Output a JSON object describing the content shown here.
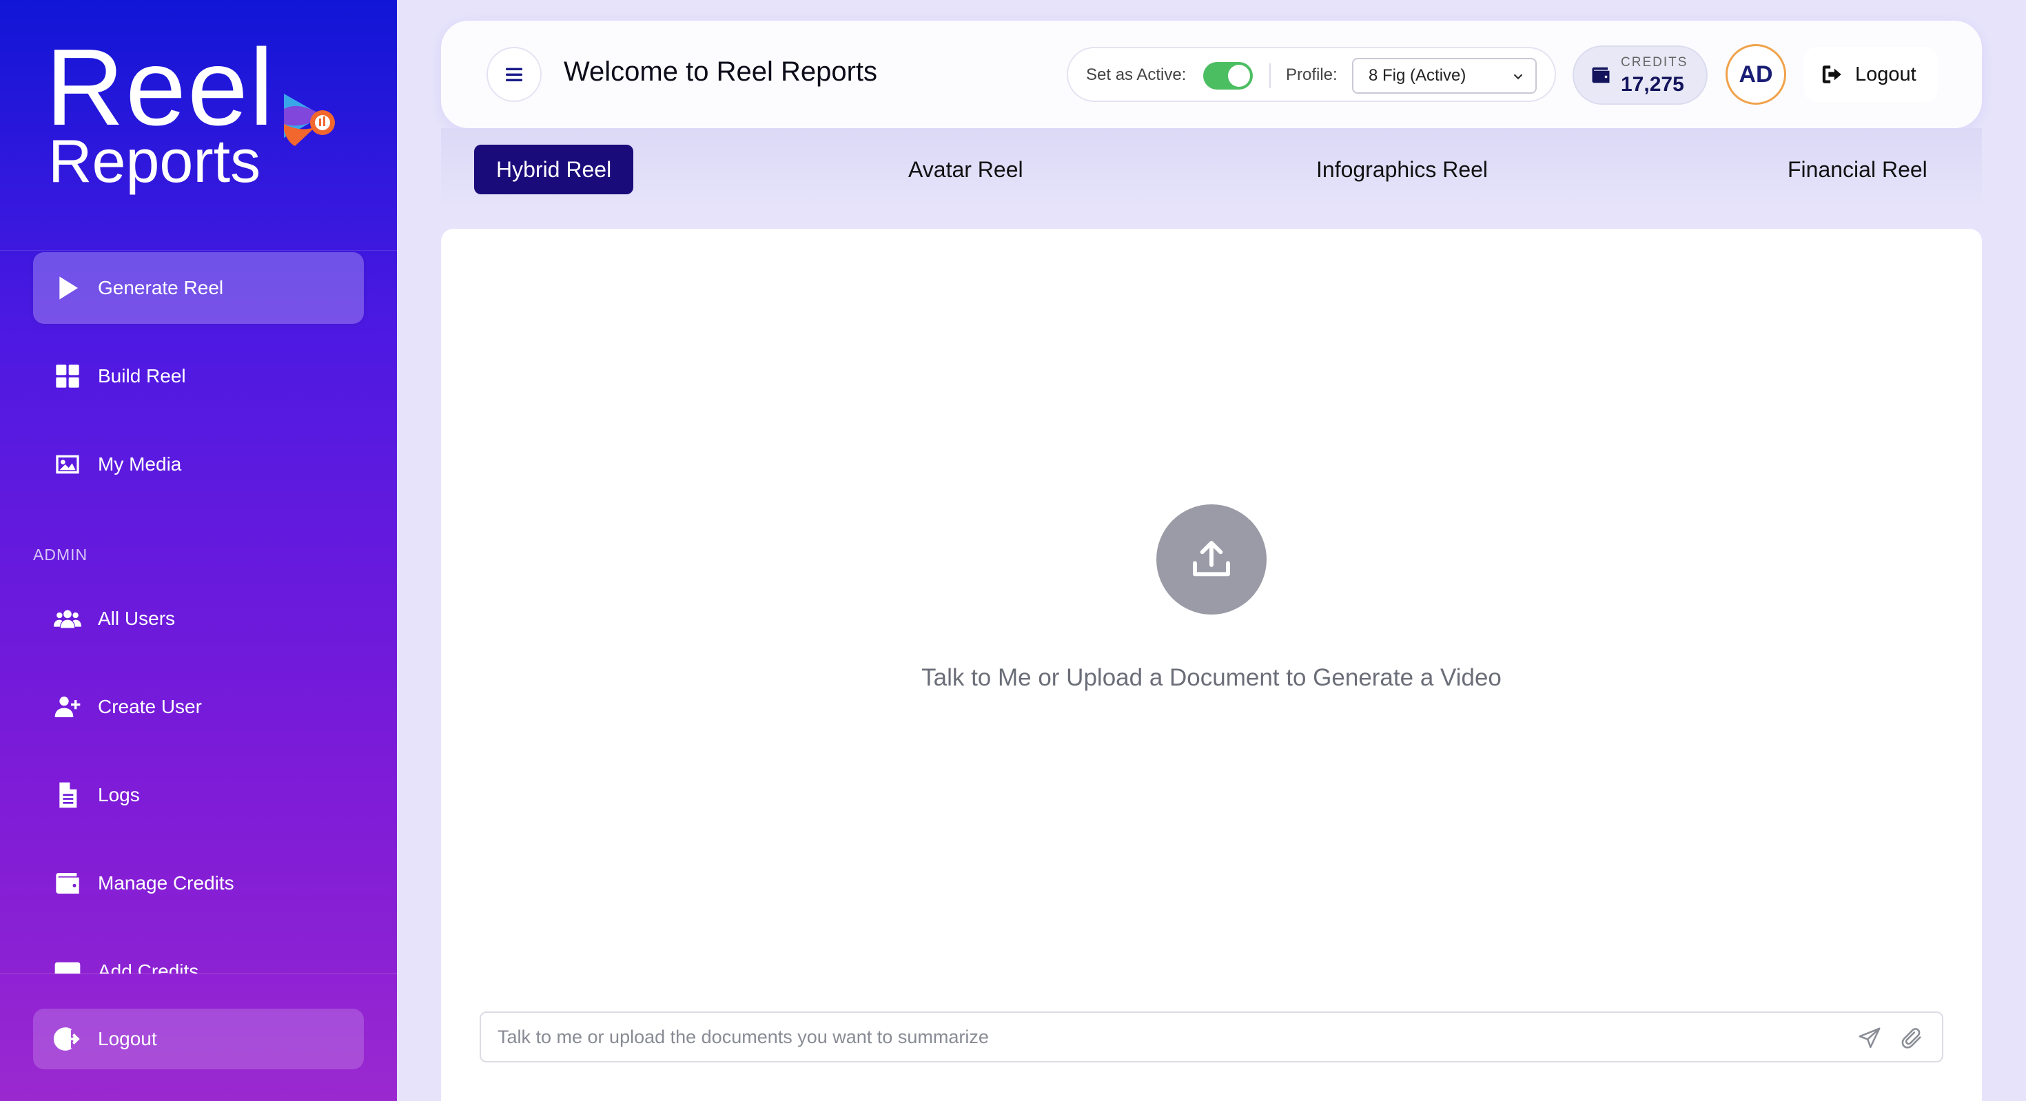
{
  "brand": {
    "logo_line1": "Reel",
    "logo_line2": "Reports"
  },
  "sidebar": {
    "items": [
      {
        "label": "Generate Reel",
        "icon": "play-icon",
        "active": true
      },
      {
        "label": "Build Reel",
        "icon": "grid-icon"
      },
      {
        "label": "My Media",
        "icon": "image-icon"
      }
    ],
    "admin_label": "ADMIN",
    "admin_items": [
      {
        "label": "All Users",
        "icon": "users-icon"
      },
      {
        "label": "Create User",
        "icon": "user-plus-icon"
      },
      {
        "label": "Logs",
        "icon": "file-icon"
      },
      {
        "label": "Manage Credits",
        "icon": "wallet-icon"
      },
      {
        "label": "Add Credits",
        "icon": "card-icon"
      }
    ],
    "logout_label": "Logout"
  },
  "header": {
    "title": "Welcome to Reel Reports",
    "set_active_label": "Set as Active:",
    "set_active_on": true,
    "profile_label": "Profile:",
    "profile_value": "8 Fig (Active)",
    "credits_label": "CREDITS",
    "credits_value": "17,275",
    "avatar_initials": "AD",
    "logout_label": "Logout"
  },
  "tabs": [
    {
      "label": "Hybrid Reel",
      "active": true
    },
    {
      "label": "Avatar Reel"
    },
    {
      "label": "Infographics Reel"
    },
    {
      "label": "Financial Reel"
    }
  ],
  "main": {
    "upload_prompt": "Talk to Me or Upload a Document to Generate a Video",
    "chat_placeholder": "Talk to me or upload the documents you want to summarize"
  },
  "colors": {
    "sidebar_top": "#1116d6",
    "sidebar_bottom": "#9526cf",
    "active_tab": "#1a0b7a",
    "toggle_on": "#4cbe62",
    "avatar_ring": "#f0a24a"
  }
}
